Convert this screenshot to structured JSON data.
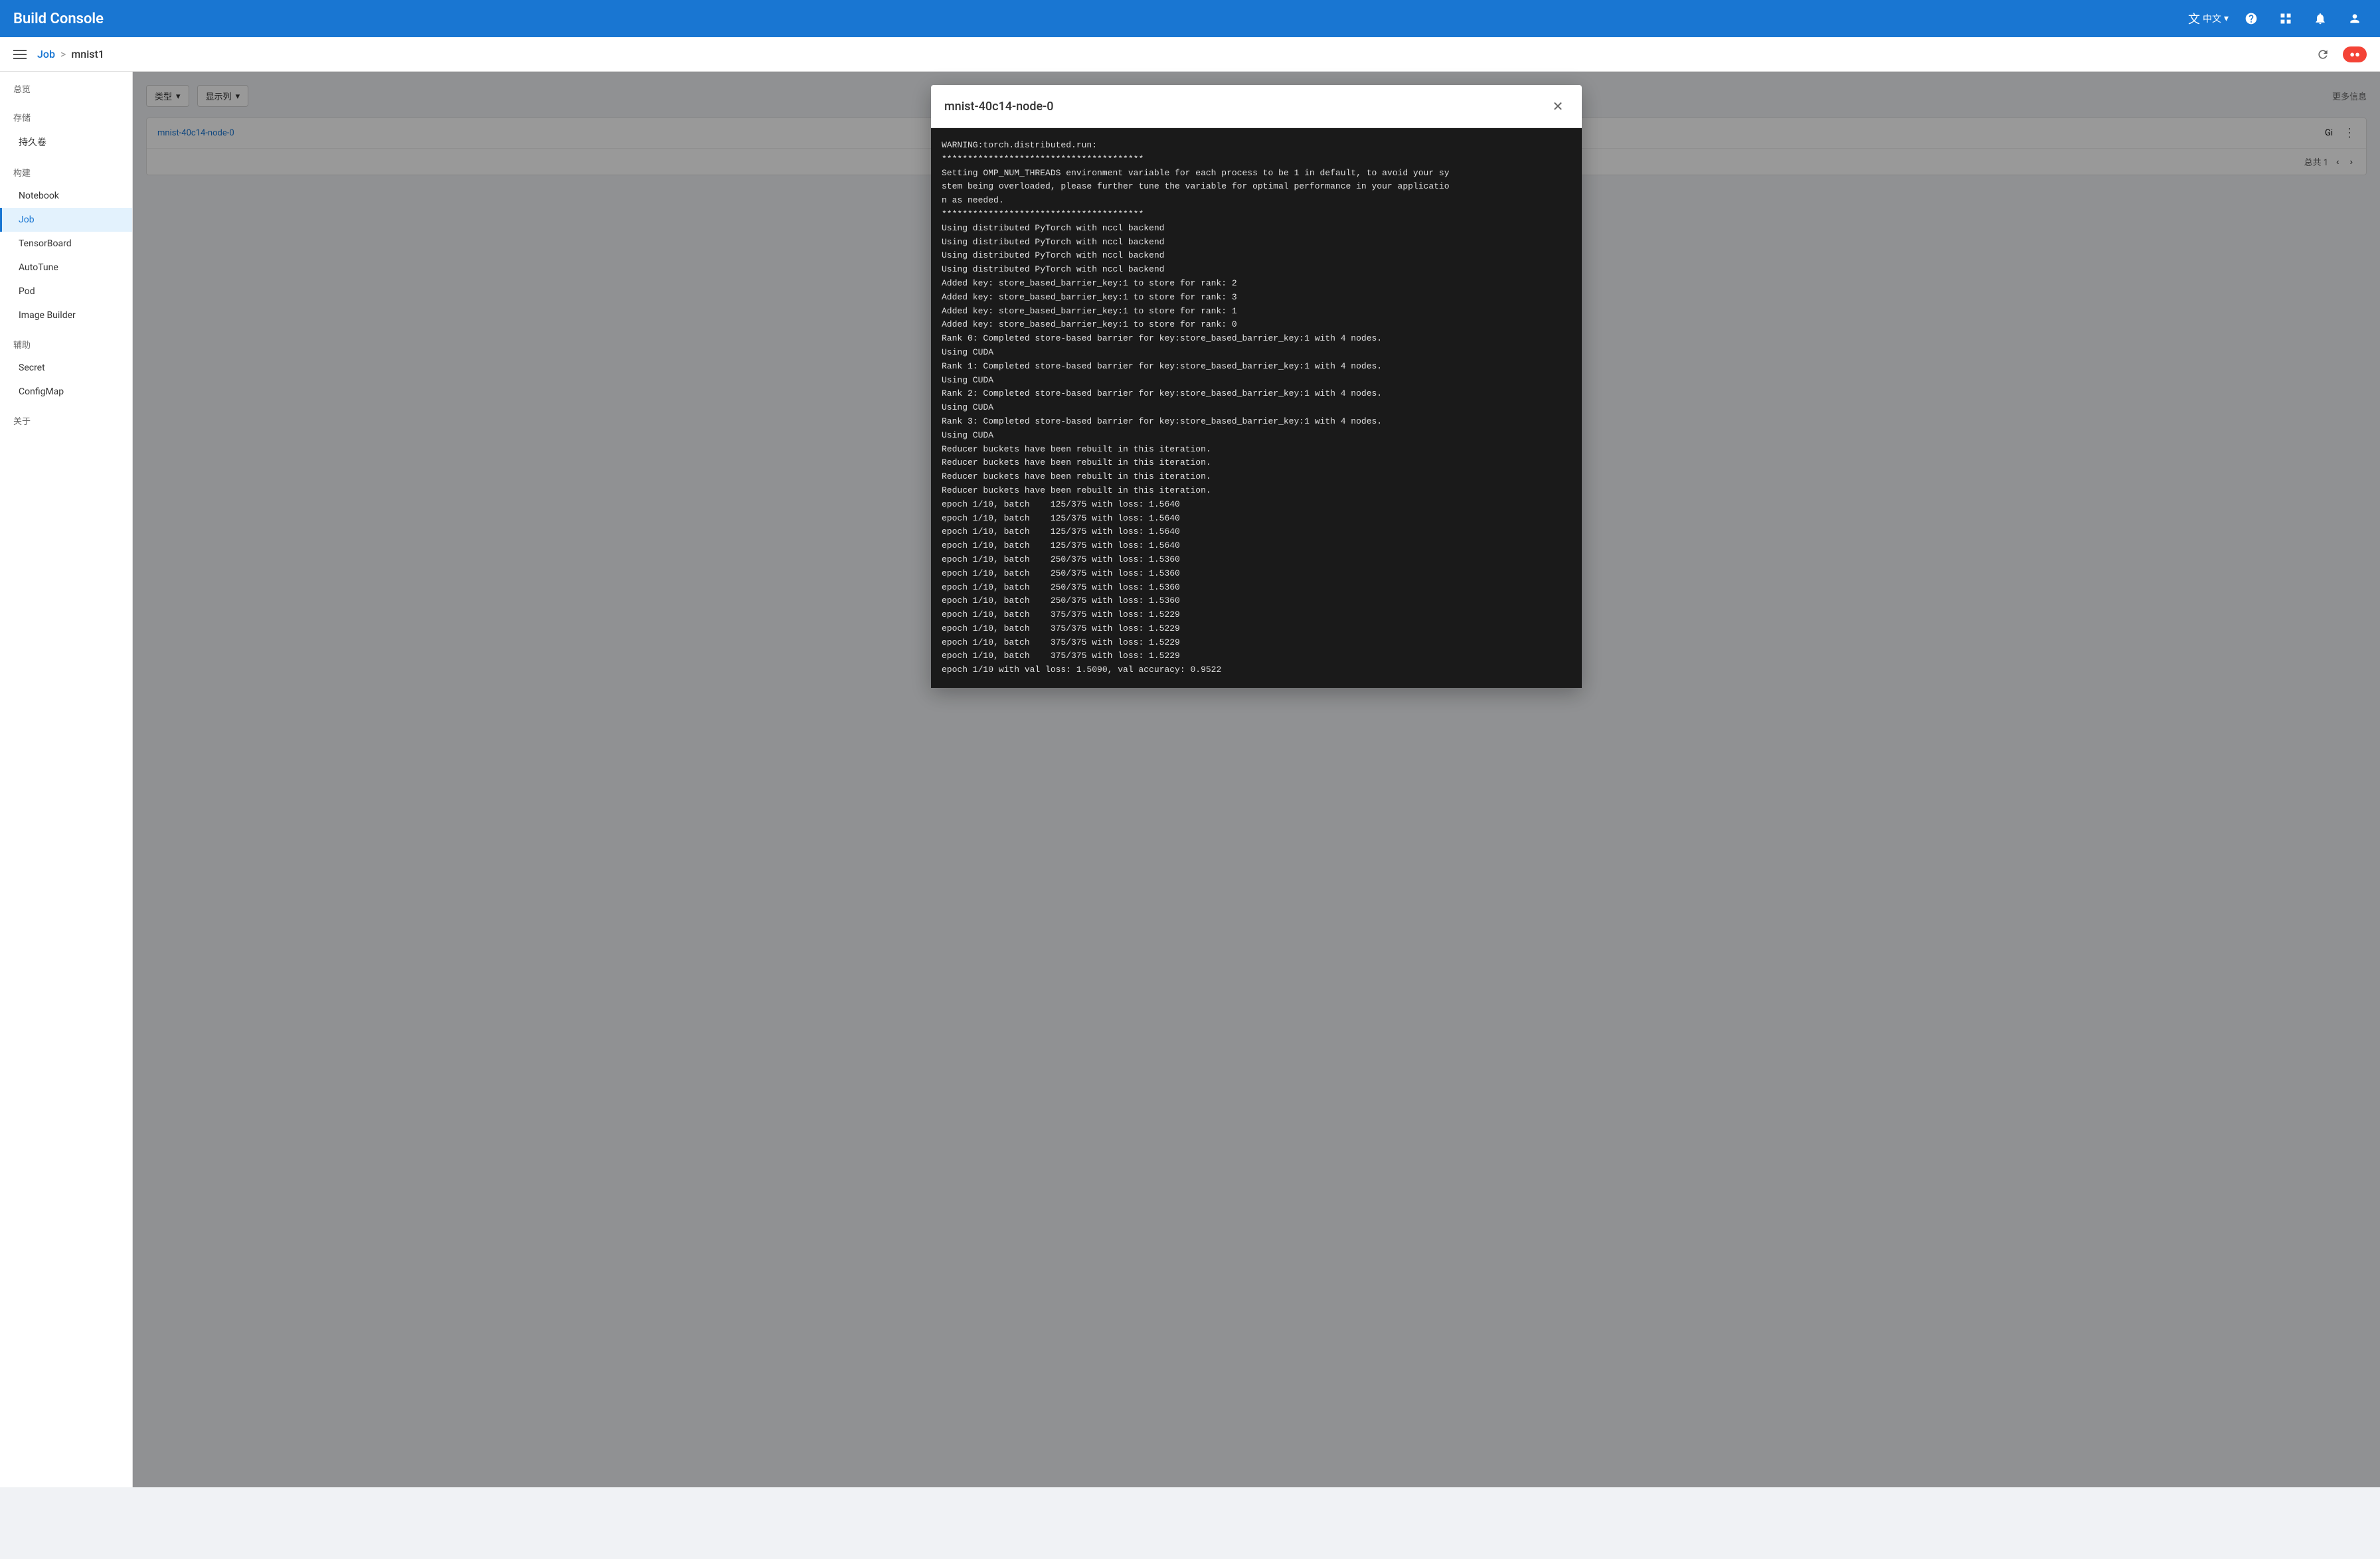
{
  "topbar": {
    "title": "Build Console",
    "lang": "中文",
    "icons": [
      "translate",
      "grid",
      "bell",
      "account"
    ]
  },
  "breadcrumb": {
    "job_label": "Job",
    "separator": ">",
    "current": "mnist1"
  },
  "sidebar": {
    "sections": [
      {
        "header": "总览",
        "items": []
      },
      {
        "header": "存储",
        "items": [
          {
            "label": "持久卷",
            "active": false
          }
        ]
      },
      {
        "header": "构建",
        "items": [
          {
            "label": "Notebook",
            "active": false
          },
          {
            "label": "Job",
            "active": true
          },
          {
            "label": "TensorBoard",
            "active": false
          },
          {
            "label": "AutoTune",
            "active": false
          },
          {
            "label": "Pod",
            "active": false
          },
          {
            "label": "Image Builder",
            "active": false
          }
        ]
      },
      {
        "header": "辅助",
        "items": [
          {
            "label": "Secret",
            "active": false
          },
          {
            "label": "ConfigMap",
            "active": false
          }
        ]
      },
      {
        "header": "关于",
        "items": []
      }
    ]
  },
  "filters": {
    "type_label": "类型",
    "columns_label": "显示列",
    "more_info": "更多信息"
  },
  "table": {
    "rows": [
      {
        "name": "mnist-40c14-node-0",
        "size": "Gi"
      }
    ],
    "total_label": "总共 1"
  },
  "modal": {
    "title": "mnist-40c14-node-0",
    "close_label": "×",
    "console_output": "WARNING:torch.distributed.run:\n***************************************\nSetting OMP_NUM_THREADS environment variable for each process to be 1 in default, to avoid your sy\nstem being overloaded, please further tune the variable for optimal performance in your applicatio\nn as needed.\n***************************************\nUsing distributed PyTorch with nccl backend\nUsing distributed PyTorch with nccl backend\nUsing distributed PyTorch with nccl backend\nUsing distributed PyTorch with nccl backend\nAdded key: store_based_barrier_key:1 to store for rank: 2\nAdded key: store_based_barrier_key:1 to store for rank: 3\nAdded key: store_based_barrier_key:1 to store for rank: 1\nAdded key: store_based_barrier_key:1 to store for rank: 0\nRank 0: Completed store-based barrier for key:store_based_barrier_key:1 with 4 nodes.\nUsing CUDA\nRank 1: Completed store-based barrier for key:store_based_barrier_key:1 with 4 nodes.\nUsing CUDA\nRank 2: Completed store-based barrier for key:store_based_barrier_key:1 with 4 nodes.\nUsing CUDA\nRank 3: Completed store-based barrier for key:store_based_barrier_key:1 with 4 nodes.\nUsing CUDA\nReducer buckets have been rebuilt in this iteration.\nReducer buckets have been rebuilt in this iteration.\nReducer buckets have been rebuilt in this iteration.\nReducer buckets have been rebuilt in this iteration.\nepoch 1/10, batch    125/375 with loss: 1.5640\nepoch 1/10, batch    125/375 with loss: 1.5640\nepoch 1/10, batch    125/375 with loss: 1.5640\nepoch 1/10, batch    125/375 with loss: 1.5640\nepoch 1/10, batch    250/375 with loss: 1.5360\nepoch 1/10, batch    250/375 with loss: 1.5360\nepoch 1/10, batch    250/375 with loss: 1.5360\nepoch 1/10, batch    250/375 with loss: 1.5360\nepoch 1/10, batch    375/375 with loss: 1.5229\nepoch 1/10, batch    375/375 with loss: 1.5229\nepoch 1/10, batch    375/375 with loss: 1.5229\nepoch 1/10, batch    375/375 with loss: 1.5229\nepoch 1/10 with val loss: 1.5090, val accuracy: 0.9522"
  },
  "status": {
    "badge_label": "●●"
  }
}
